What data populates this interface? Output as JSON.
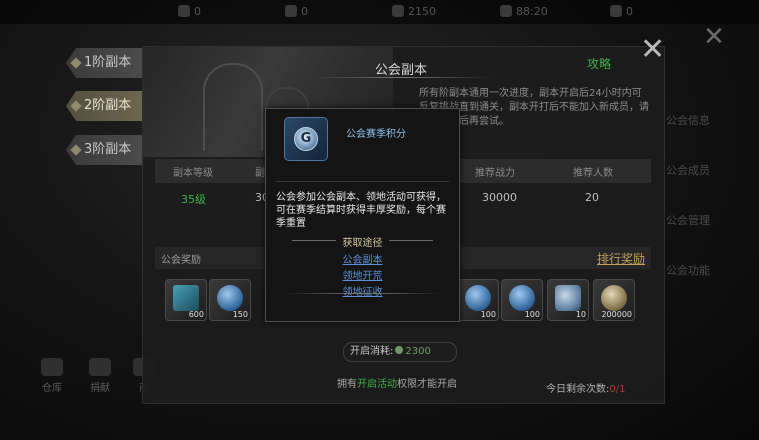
{
  "background": {
    "title": "",
    "tabs": [
      {
        "label": "1阶副本",
        "active": false
      },
      {
        "label": "2阶副本",
        "active": true
      },
      {
        "label": "3阶副本",
        "active": false
      }
    ],
    "side_menu": [
      "公会信息",
      "公会成员",
      "公会管理",
      "公会功能"
    ],
    "bottom_buttons": [
      "仓库",
      "捐献",
      "商"
    ],
    "resources": [
      "0",
      "0",
      "2150",
      "88:20",
      "0"
    ]
  },
  "panel": {
    "title": "公会副本",
    "guide_label": "攻略",
    "description": "所有阶副本通用一次进度，副本开启后24小时内可反复挑战直到通关，副本开打后不能加入新成员，请确认人员后再尝试。",
    "table": {
      "headers": [
        "副本等级",
        "副本",
        "推荐战力",
        "推荐人数"
      ],
      "row": [
        "35级",
        "30",
        "30000",
        "20"
      ]
    },
    "rewards": {
      "label": "公会奖励",
      "rank_label": "排行奖励",
      "items": [
        {
          "icon": "guild-flag-icon",
          "count": "600"
        },
        {
          "icon": "guild-season-points-icon",
          "count": "150"
        },
        {
          "icon": "blue-orb-icon",
          "count": "100"
        },
        {
          "icon": "blue-coin-icon",
          "count": "100"
        },
        {
          "icon": "blue-ore-icon",
          "count": "10"
        },
        {
          "icon": "gold-coin-icon",
          "count": "200000"
        }
      ]
    },
    "cost": {
      "label": "开启消耗:",
      "value": "2300"
    },
    "requirement": {
      "pre": "拥有",
      "highlight": "开启活动",
      "post": "权限才能开启"
    },
    "today": {
      "label": "今日剩余次数:",
      "value": "0/1"
    }
  },
  "tooltip": {
    "title": "公会赛季积分",
    "description": "公会参加公会副本、领地活动可获得，可在赛季结算时获得丰厚奖励，每个赛季重置",
    "section_label": "获取途径",
    "links": [
      "公会副本",
      "领地开荒",
      "领地征收"
    ],
    "colors": {
      "title": "#8cc0ea",
      "link": "#5a8fd6"
    }
  },
  "colors": {
    "accent_green": "#3fb04a",
    "rank_gold": "#c3a05a",
    "warn_red": "#b13838"
  }
}
